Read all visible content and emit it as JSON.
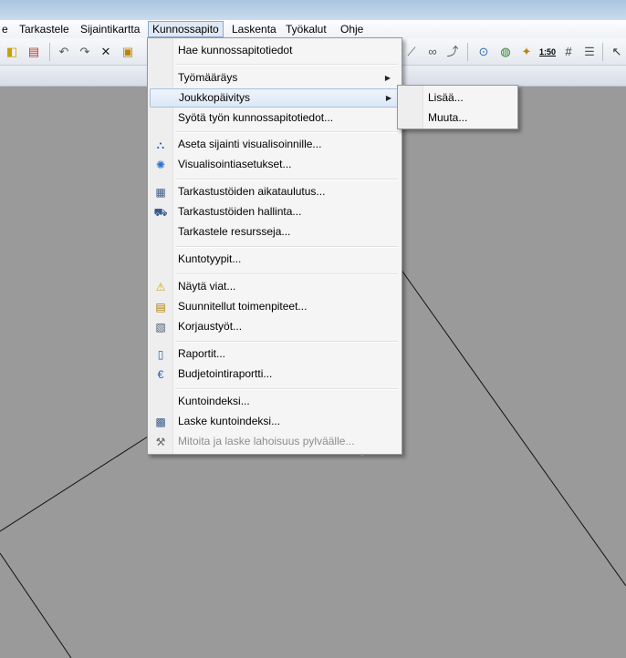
{
  "menubar": {
    "items": [
      {
        "label": "e"
      },
      {
        "label": "Tarkastele"
      },
      {
        "label": "Sijaintikartta"
      },
      {
        "label": "Kunnossapito"
      },
      {
        "label": "Laskenta"
      },
      {
        "label": "Työkalut"
      },
      {
        "label": "Ohje"
      }
    ]
  },
  "toolbar": {
    "icons": [
      "app-icon",
      "folder-icon",
      "undo-icon",
      "redo-icon",
      "delete-icon",
      "package-icon",
      "node-icon",
      "link-icon",
      "path-icon",
      "settings-icon",
      "globe-icon",
      "map-icon",
      "scale-icon",
      "grid-icon",
      "layers-icon",
      "pointer-icon"
    ],
    "scale_label": "1:50"
  },
  "kunnossapito_menu": {
    "items": [
      {
        "label": "Hae kunnossapitotiedot",
        "icon": ""
      },
      {
        "label": "Työmääräys",
        "icon": "",
        "submenu": true
      },
      {
        "label": "Joukkopäivitys",
        "icon": "",
        "submenu": true,
        "highlighted": true
      },
      {
        "label": "Syötä työn kunnossapitotiedot...",
        "icon": ""
      },
      {
        "label": "Aseta sijainti visualisoinnille...",
        "icon": "locate-icon"
      },
      {
        "label": "Visualisointiasetukset...",
        "icon": "visual-settings-icon"
      },
      {
        "label": "Tarkastustöiden aikataulutus...",
        "icon": "schedule-icon"
      },
      {
        "label": "Tarkastustöiden hallinta...",
        "icon": "inspection-icon"
      },
      {
        "label": "Tarkastele resursseja...",
        "icon": ""
      },
      {
        "label": "Kuntotyypit...",
        "icon": ""
      },
      {
        "label": "Näytä viat...",
        "icon": "warning-icon"
      },
      {
        "label": "Suunnitellut toimenpiteet...",
        "icon": "clipboard-icon"
      },
      {
        "label": "Korjaustyöt...",
        "icon": "repair-icon"
      },
      {
        "label": "Raportit...",
        "icon": "report-icon"
      },
      {
        "label": "Budjetointiraportti...",
        "icon": "budget-icon"
      },
      {
        "label": "Kuntoindeksi...",
        "icon": ""
      },
      {
        "label": "Laske kuntoindeksi...",
        "icon": "calculate-icon"
      },
      {
        "label": "Mitoita ja laske lahoisuus pylväälle...",
        "icon": "pole-icon",
        "disabled": true
      }
    ]
  },
  "joukkopaivitys_submenu": {
    "items": [
      {
        "label": "Lisää..."
      },
      {
        "label": "Muuta..."
      }
    ]
  },
  "colors": {
    "canvas": "#9a9a9a",
    "menu_bg": "#f5f5f5",
    "highlight": "#dce8f7",
    "disabled_text": "#8d8d8d"
  }
}
